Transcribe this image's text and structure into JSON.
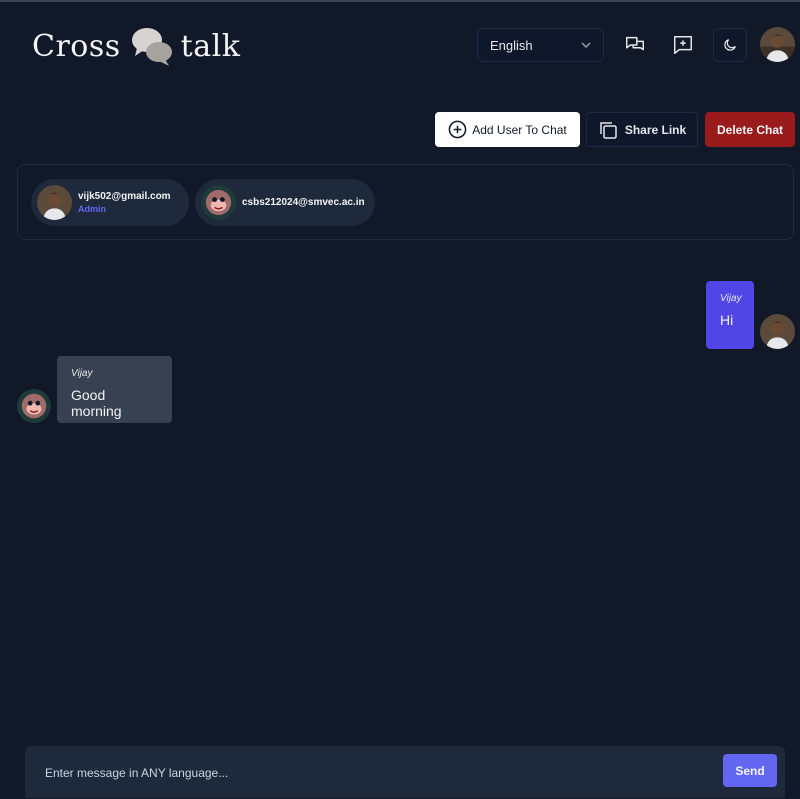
{
  "header": {
    "logo_left": "Cross",
    "logo_right": "talk",
    "language": {
      "selected": "English"
    },
    "icons": [
      "chats-icon",
      "new-chat-icon",
      "moon-icon"
    ]
  },
  "actions": {
    "add_user_label": "Add User To Chat",
    "share_label": "Share Link",
    "delete_label": "Delete Chat"
  },
  "members": [
    {
      "email": "vijk502@gmail.com",
      "role": "Admin"
    },
    {
      "email": "csbs212024@smvec.ac.in",
      "role": ""
    }
  ],
  "messages": [
    {
      "sender": "Vijay",
      "text": "Hi",
      "direction": "outgoing"
    },
    {
      "sender": "Vijay",
      "text": "Good morning",
      "direction": "incoming"
    }
  ],
  "composer": {
    "placeholder": "Enter message in ANY language...",
    "send_label": "Send"
  },
  "colors": {
    "background": "#111827",
    "accent": "#6366f1",
    "outgoing_bubble": "#4f46e5",
    "incoming_bubble": "#374151",
    "danger": "#991b1b"
  }
}
